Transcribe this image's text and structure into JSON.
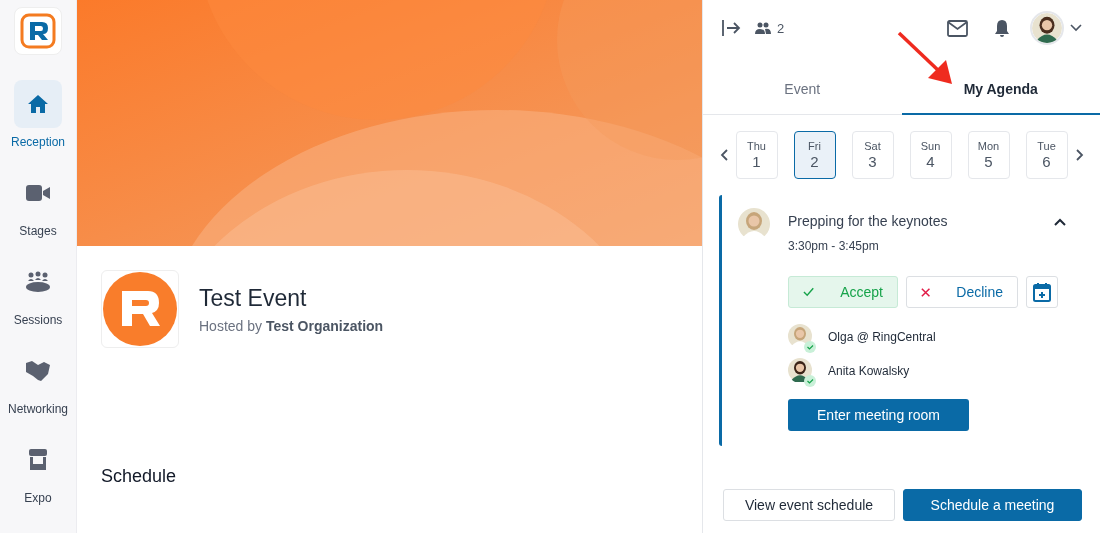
{
  "sidebar": {
    "items": [
      {
        "label": "Reception",
        "selected": true
      },
      {
        "label": "Stages",
        "selected": false
      },
      {
        "label": "Sessions",
        "selected": false
      },
      {
        "label": "Networking",
        "selected": false
      },
      {
        "label": "Expo",
        "selected": false
      }
    ]
  },
  "event": {
    "title": "Test Event",
    "hosted_by": "Hosted by **Test Organization**",
    "section_heading": "Schedule"
  },
  "panel": {
    "attendee_count": "2",
    "tabs": [
      {
        "label": "Event",
        "selected": false
      },
      {
        "label": "My Agenda",
        "selected": true
      }
    ],
    "days": [
      {
        "weekday": "Thu",
        "day": "1",
        "selected": false
      },
      {
        "weekday": "Fri",
        "day": "2",
        "selected": true
      },
      {
        "weekday": "Sat",
        "day": "3",
        "selected": false
      },
      {
        "weekday": "Sun",
        "day": "4",
        "selected": false
      },
      {
        "weekday": "Mon",
        "day": "5",
        "selected": false
      },
      {
        "weekday": "Tue",
        "day": "6",
        "selected": false
      }
    ],
    "meeting": {
      "title": "Prepping for the keynotes",
      "time": "3:30pm - 3:45pm",
      "expanded": true,
      "responses": [
        {
          "kind": "accept",
          "label": "Accept",
          "selected": true
        },
        {
          "kind": "decline",
          "label": "Decline",
          "selected": false
        }
      ],
      "attendees": [
        {
          "name": "Olga @ RingCentral",
          "accepted": true
        },
        {
          "name": "Anita Kowalsky",
          "accepted": true
        }
      ],
      "enter_button": "Enter meeting room"
    },
    "footer_buttons": [
      {
        "label": "View event schedule",
        "kind": "secondary"
      },
      {
        "label": "Schedule a meeting",
        "kind": "primary"
      }
    ]
  }
}
